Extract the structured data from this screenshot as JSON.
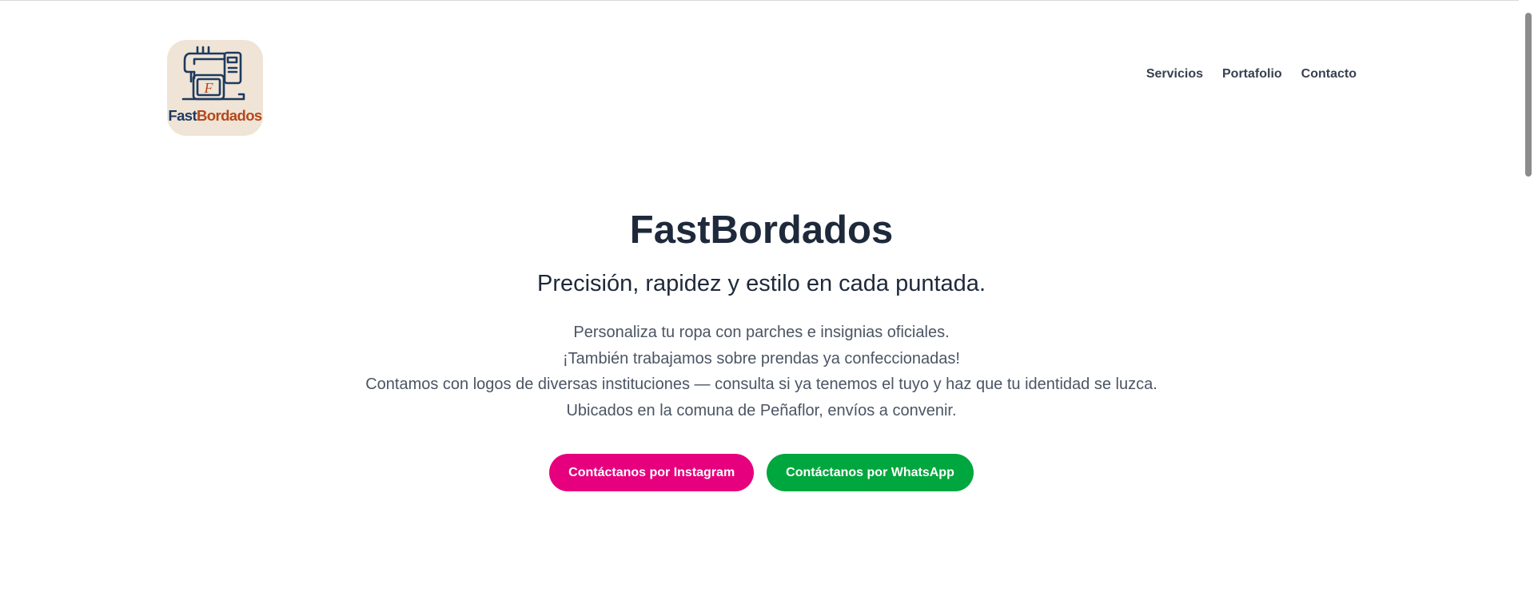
{
  "brand": {
    "logo_alt": "FastBordados",
    "logo_word_fast": "Fast",
    "logo_word_bordados": "Bordados",
    "logo_monogram": "F",
    "logo_bg": "#efe4d6",
    "navy": "#1e3a5f",
    "rust": "#b5471b"
  },
  "nav": {
    "items": [
      {
        "label": "Servicios"
      },
      {
        "label": "Portafolio"
      },
      {
        "label": "Contacto"
      }
    ]
  },
  "hero": {
    "title": "FastBordados",
    "subtitle": "Precisión, rapidez y estilo en cada puntada.",
    "lines": [
      "Personaliza tu ropa con parches e insignias oficiales.",
      "¡También trabajamos sobre prendas ya confeccionadas!",
      "Contamos con logos de diversas instituciones — consulta si ya tenemos el tuyo y haz que tu identidad se luzca.",
      "Ubicados en la comuna de Peñaflor, envíos a convenir."
    ]
  },
  "cta": {
    "instagram_label": "Contáctanos por Instagram",
    "instagram_color": "#e6007e",
    "whatsapp_label": "Contáctanos por WhatsApp",
    "whatsapp_color": "#00a63e"
  },
  "icons": {
    "logo_icon": "sewing-machine-icon"
  }
}
